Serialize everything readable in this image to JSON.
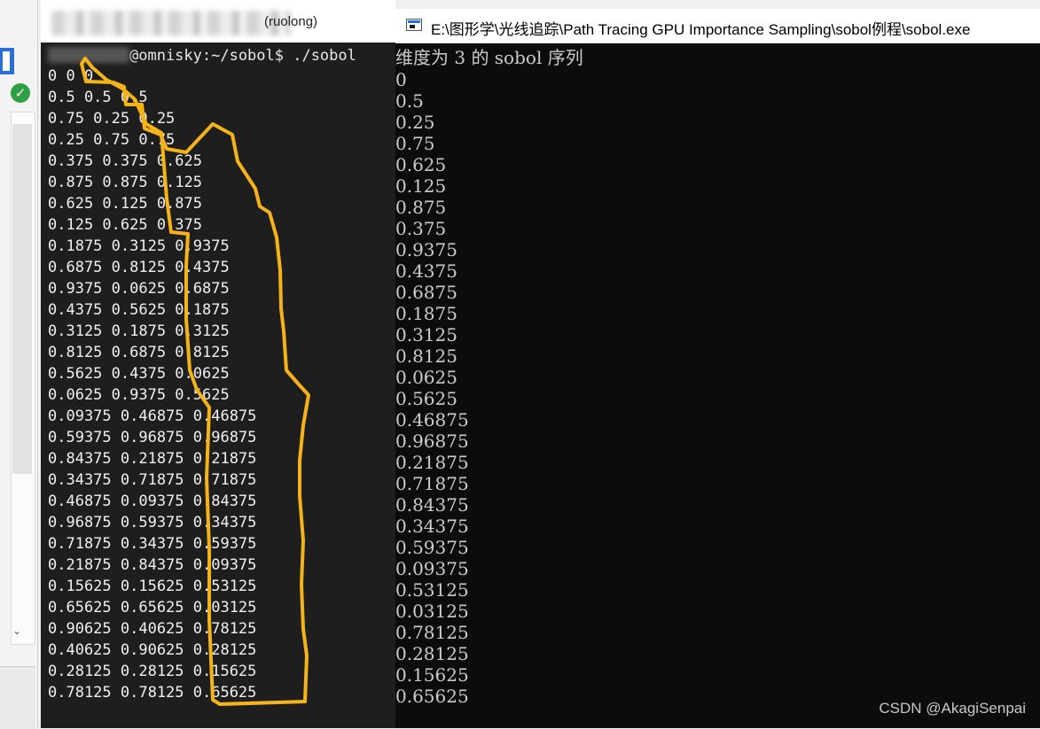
{
  "terminal": {
    "title_suffix": "(ruolong)",
    "prompt": "@omnisky:~/sobol$ ./sobol",
    "lines": [
      "0 0 0",
      "0.5 0.5 0.5",
      "0.75 0.25 0.25",
      "0.25 0.75 0.75",
      "0.375 0.375 0.625",
      "0.875 0.875 0.125",
      "0.625 0.125 0.875",
      "0.125 0.625 0.375",
      "0.1875 0.3125 0.9375",
      "0.6875 0.8125 0.4375",
      "0.9375 0.0625 0.6875",
      "0.4375 0.5625 0.1875",
      "0.3125 0.1875 0.3125",
      "0.8125 0.6875 0.8125",
      "0.5625 0.4375 0.0625",
      "0.0625 0.9375 0.5625",
      "0.09375 0.46875 0.46875",
      "0.59375 0.96875 0.96875",
      "0.84375 0.21875 0.21875",
      "0.34375 0.71875 0.71875",
      "0.46875 0.09375 0.84375",
      "0.96875 0.59375 0.34375",
      "0.71875 0.34375 0.59375",
      "0.21875 0.84375 0.09375",
      "0.15625 0.15625 0.53125",
      "0.65625 0.65625 0.03125",
      "0.90625 0.40625 0.78125",
      "0.40625 0.90625 0.28125",
      "0.28125 0.28125 0.15625",
      "0.78125 0.78125 0.65625"
    ]
  },
  "console": {
    "title": "E:\\图形学\\光线追踪\\Path Tracing GPU Importance Sampling\\sobol例程\\sobol.exe",
    "header": "维度为 3 的 sobol 序列",
    "lines": [
      "0",
      "0.5",
      "0.25",
      "0.75",
      "0.625",
      "0.125",
      "0.875",
      "0.375",
      "0.9375",
      "0.4375",
      "0.6875",
      "0.1875",
      "0.3125",
      "0.8125",
      "0.0625",
      "0.5625",
      "0.46875",
      "0.96875",
      "0.21875",
      "0.71875",
      "0.84375",
      "0.34375",
      "0.59375",
      "0.09375",
      "0.53125",
      "0.03125",
      "0.78125",
      "0.28125",
      "0.15625",
      "0.65625"
    ]
  },
  "watermark": "CSDN @AkagiSenpai",
  "colors": {
    "annotation": "#f5b318",
    "terminal_bg": "#1e1e1e",
    "console_bg": "#0c0c0c"
  },
  "icons": {
    "status": "check-icon",
    "console": "console-window-icon"
  }
}
